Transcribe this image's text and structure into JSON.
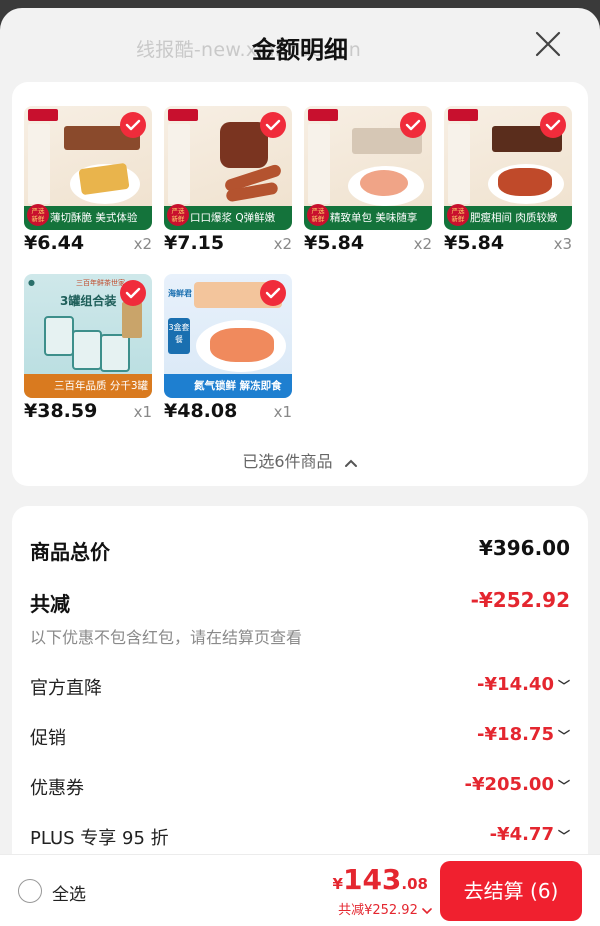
{
  "header": {
    "title": "金额明细",
    "watermark": "线报酷-new.xianbao.fun"
  },
  "products": [
    {
      "price": "¥6.44",
      "qty": "x2",
      "banner": "薄切酥脆 美式体验",
      "logo": "Hormel"
    },
    {
      "price": "¥7.15",
      "qty": "x2",
      "banner": "口口爆浆 Q弹鲜嫩",
      "logo": "Hormel"
    },
    {
      "price": "¥5.84",
      "qty": "x2",
      "banner": "精致单包 美味随享",
      "logo": "Hormel"
    },
    {
      "price": "¥5.84",
      "qty": "x3",
      "banner": "肥瘦相间 肉质较嫩",
      "logo": "Hormel"
    },
    {
      "price": "¥38.59",
      "qty": "x1",
      "top_label": "三百年鲜茶世家",
      "box_label": "3罐组合装",
      "banner": "三百年品质 分千3罐"
    },
    {
      "price": "¥48.08",
      "qty": "x1",
      "brand": "海鲜君",
      "set_label": "3盒套餐",
      "banner": "氮气锁鲜 解冻即食"
    }
  ],
  "selected_info": "已选6件商品",
  "summary": {
    "total_label": "商品总价",
    "total_value": "¥396.00",
    "reduce_label": "共减",
    "reduce_value": "-¥252.92",
    "note": "以下优惠不包含红包，请在结算页查看",
    "items": [
      {
        "label": "官方直降",
        "value": "-¥14.40"
      },
      {
        "label": "促销",
        "value": "-¥18.75"
      },
      {
        "label": "优惠券",
        "value": "-¥205.00"
      },
      {
        "label": "PLUS 专享 95 折",
        "value": "-¥4.77"
      }
    ]
  },
  "bottom": {
    "select_all": "全选",
    "currency": "¥",
    "total_int": "143",
    "total_dec": ".08",
    "reduced": "共减¥252.92",
    "checkout": "去结算 (6)"
  },
  "colors": {
    "accent_red": "#e4262f",
    "button_red": "#f0202f",
    "product_green": "#14733b"
  }
}
